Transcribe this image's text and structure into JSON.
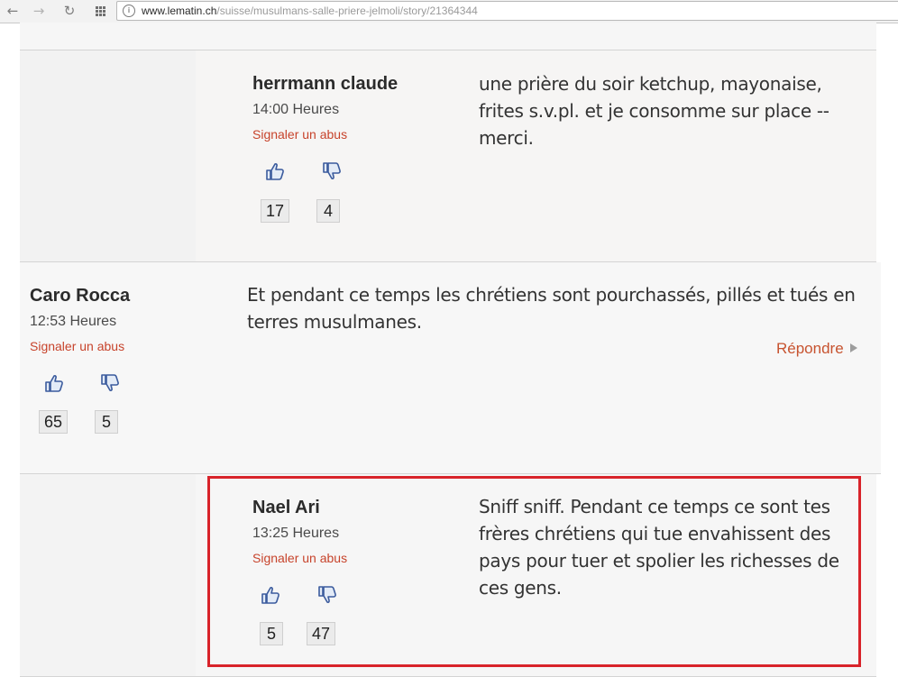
{
  "browser": {
    "url_domain": "www.lematin.ch",
    "url_path": "/suisse/musulmans-salle-priere-jelmoli/story/21364344"
  },
  "comments": [
    {
      "author": "herrmann claude",
      "time": "14:00 Heures",
      "report": "Signaler un abus",
      "likes": "17",
      "dislikes": "4",
      "text": "une prière du soir ketchup, mayonaise, frites s.v.pl. et je consomme sur place -- merci."
    },
    {
      "author": "Caro Rocca",
      "time": "12:53 Heures",
      "report": "Signaler un abus",
      "likes": "65",
      "dislikes": "5",
      "text": "Et pendant ce temps les chrétiens sont pourchassés, pillés et tués en terres musulmanes.",
      "reply": "Répondre"
    },
    {
      "author": "Nael Ari",
      "time": "13:25 Heures",
      "report": "Signaler un abus",
      "likes": "5",
      "dislikes": "47",
      "text": "Sniff sniff. Pendant ce temps ce sont tes frères chrétiens qui tue envahissent des pays pour tuer et spolier les richesses de ces gens."
    }
  ],
  "colors": {
    "report_link": "#c7432b",
    "reply_link": "#c7532f",
    "vote_icon": "#3b5b9d",
    "highlight_border": "#d8232a"
  }
}
